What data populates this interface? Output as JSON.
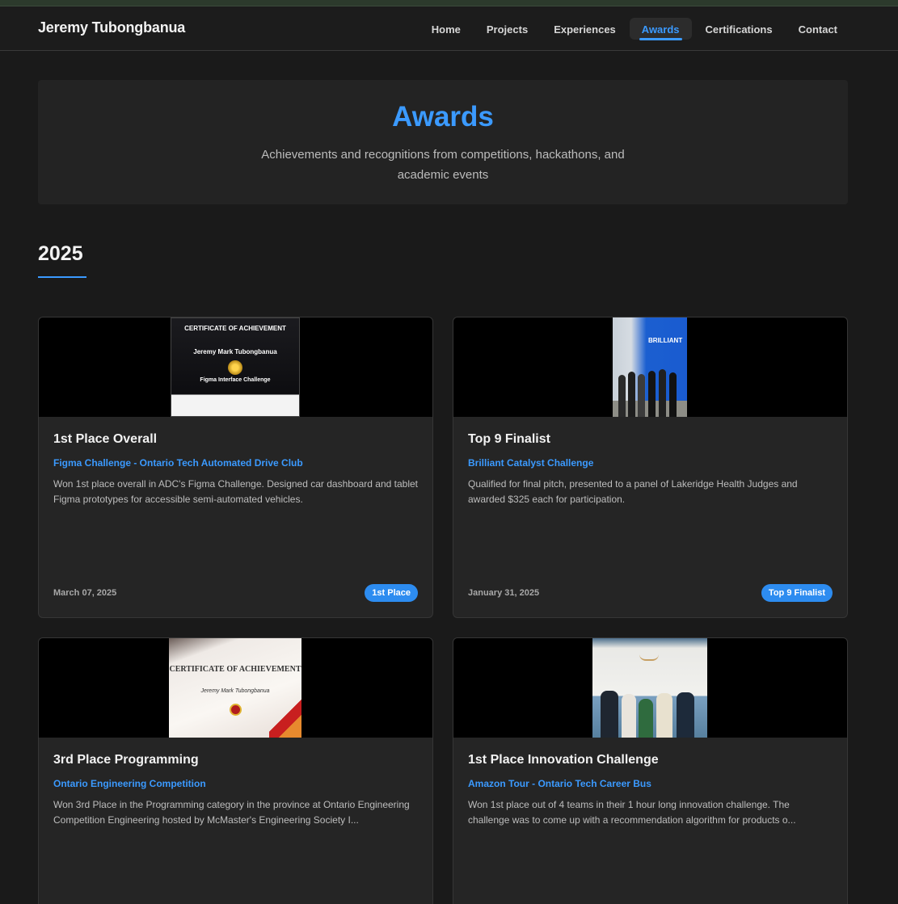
{
  "brand": "Jeremy Tubongbanua",
  "nav": [
    {
      "label": "Home",
      "active": false
    },
    {
      "label": "Projects",
      "active": false
    },
    {
      "label": "Experiences",
      "active": false
    },
    {
      "label": "Awards",
      "active": true
    },
    {
      "label": "Certifications",
      "active": false
    },
    {
      "label": "Contact",
      "active": false
    }
  ],
  "hero": {
    "title": "Awards",
    "subtitle": "Achievements and recognitions from competitions, hackathons, and academic events"
  },
  "section": {
    "year": "2025"
  },
  "images": {
    "cert1_head": "CERTIFICATE OF ACHIEVEMENT",
    "cert1_name": "Jeremy Mark Tubongbanua",
    "cert1_sub": "Figma Interface Challenge",
    "photo2_wall": "BRILLIANT",
    "cert3_head": "CERTIFICATE OF ACHIEVEMENT",
    "cert3_name": "Jeremy Mark Tubongbanua"
  },
  "cards": [
    {
      "title": "1st Place Overall",
      "org": "Figma Challenge - Ontario Tech Automated Drive Club",
      "description": "Won 1st place overall in ADC's Figma Challenge. Designed car dashboard and tablet Figma prototypes for accessible semi-automated vehicles.",
      "date": "March 07, 2025",
      "badge": "1st Place"
    },
    {
      "title": "Top 9 Finalist",
      "org": "Brilliant Catalyst Challenge",
      "description": "Qualified for final pitch, presented to a panel of Lakeridge Health Judges and awarded $325 each for participation.",
      "date": "January 31, 2025",
      "badge": "Top 9 Finalist"
    },
    {
      "title": "3rd Place Programming",
      "org": "Ontario Engineering Competition",
      "description": "Won 3rd Place in the Programming category in the province at Ontario Engineering Competition Engineering hosted by McMaster's Engineering Society I...",
      "date": "",
      "badge": ""
    },
    {
      "title": "1st Place Innovation Challenge",
      "org": "Amazon Tour - Ontario Tech Career Bus",
      "description": "Won 1st place out of 4 teams in their 1 hour long innovation challenge. The challenge was to come up with a recommendation algorithm for products o...",
      "date": "",
      "badge": ""
    }
  ],
  "colors": {
    "accent": "#3b9aff",
    "background": "#1a1a1a",
    "card": "#252525",
    "badge": "#2d8cf0"
  }
}
